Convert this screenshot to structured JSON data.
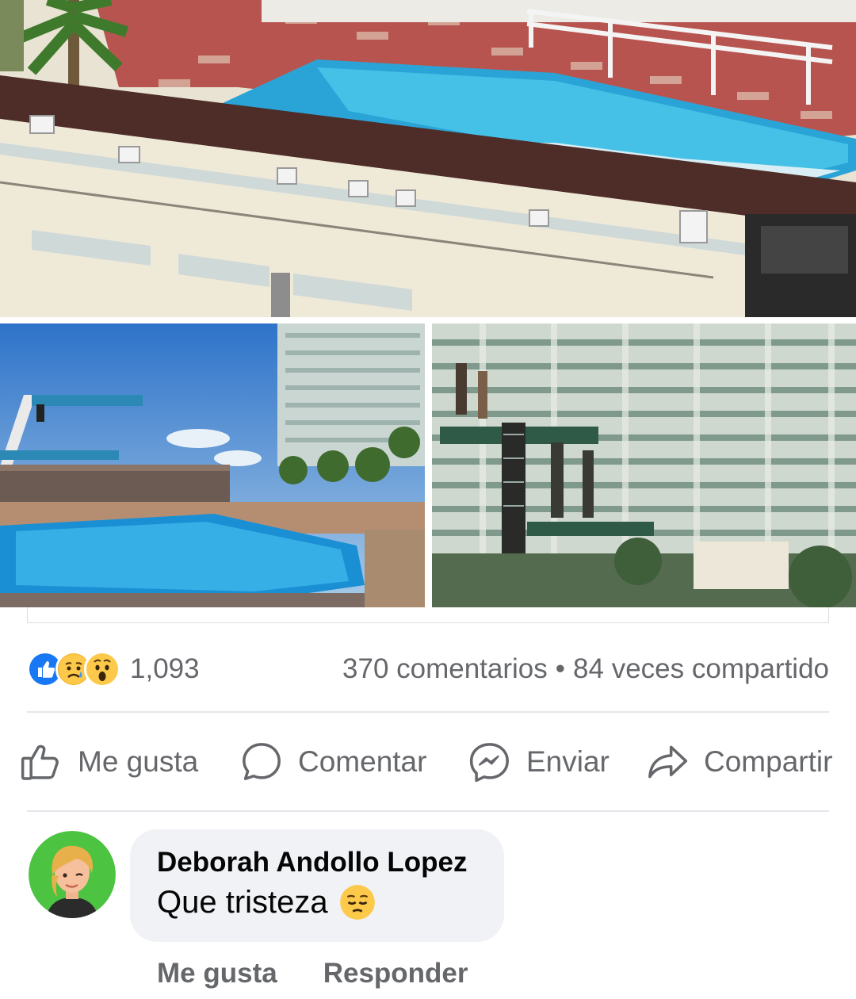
{
  "post": {
    "photos": [
      {
        "description_icon": "rooftop-pool-photo"
      },
      {
        "description_icon": "diving-pool-photo"
      },
      {
        "description_icon": "hotel-divers-photo"
      }
    ],
    "reactions": {
      "types": [
        "like",
        "sad",
        "wow"
      ],
      "count": "1,093"
    },
    "stats": {
      "comments": "370 comentarios",
      "separator": "•",
      "shares": "84 veces compartido"
    },
    "actions": {
      "like": "Me gusta",
      "comment": "Comentar",
      "send": "Enviar",
      "share": "Compartir"
    }
  },
  "comment": {
    "author": "Deborah Andollo Lopez",
    "text": "Que tristeza",
    "emoji": "pensive-face",
    "like_label": "Me gusta",
    "reply_label": "Responder"
  },
  "colors": {
    "like_blue": "#1877f2",
    "muted_text": "#65676b",
    "bubble_bg": "#f0f2f5",
    "avatar_bg": "#4cc341"
  }
}
